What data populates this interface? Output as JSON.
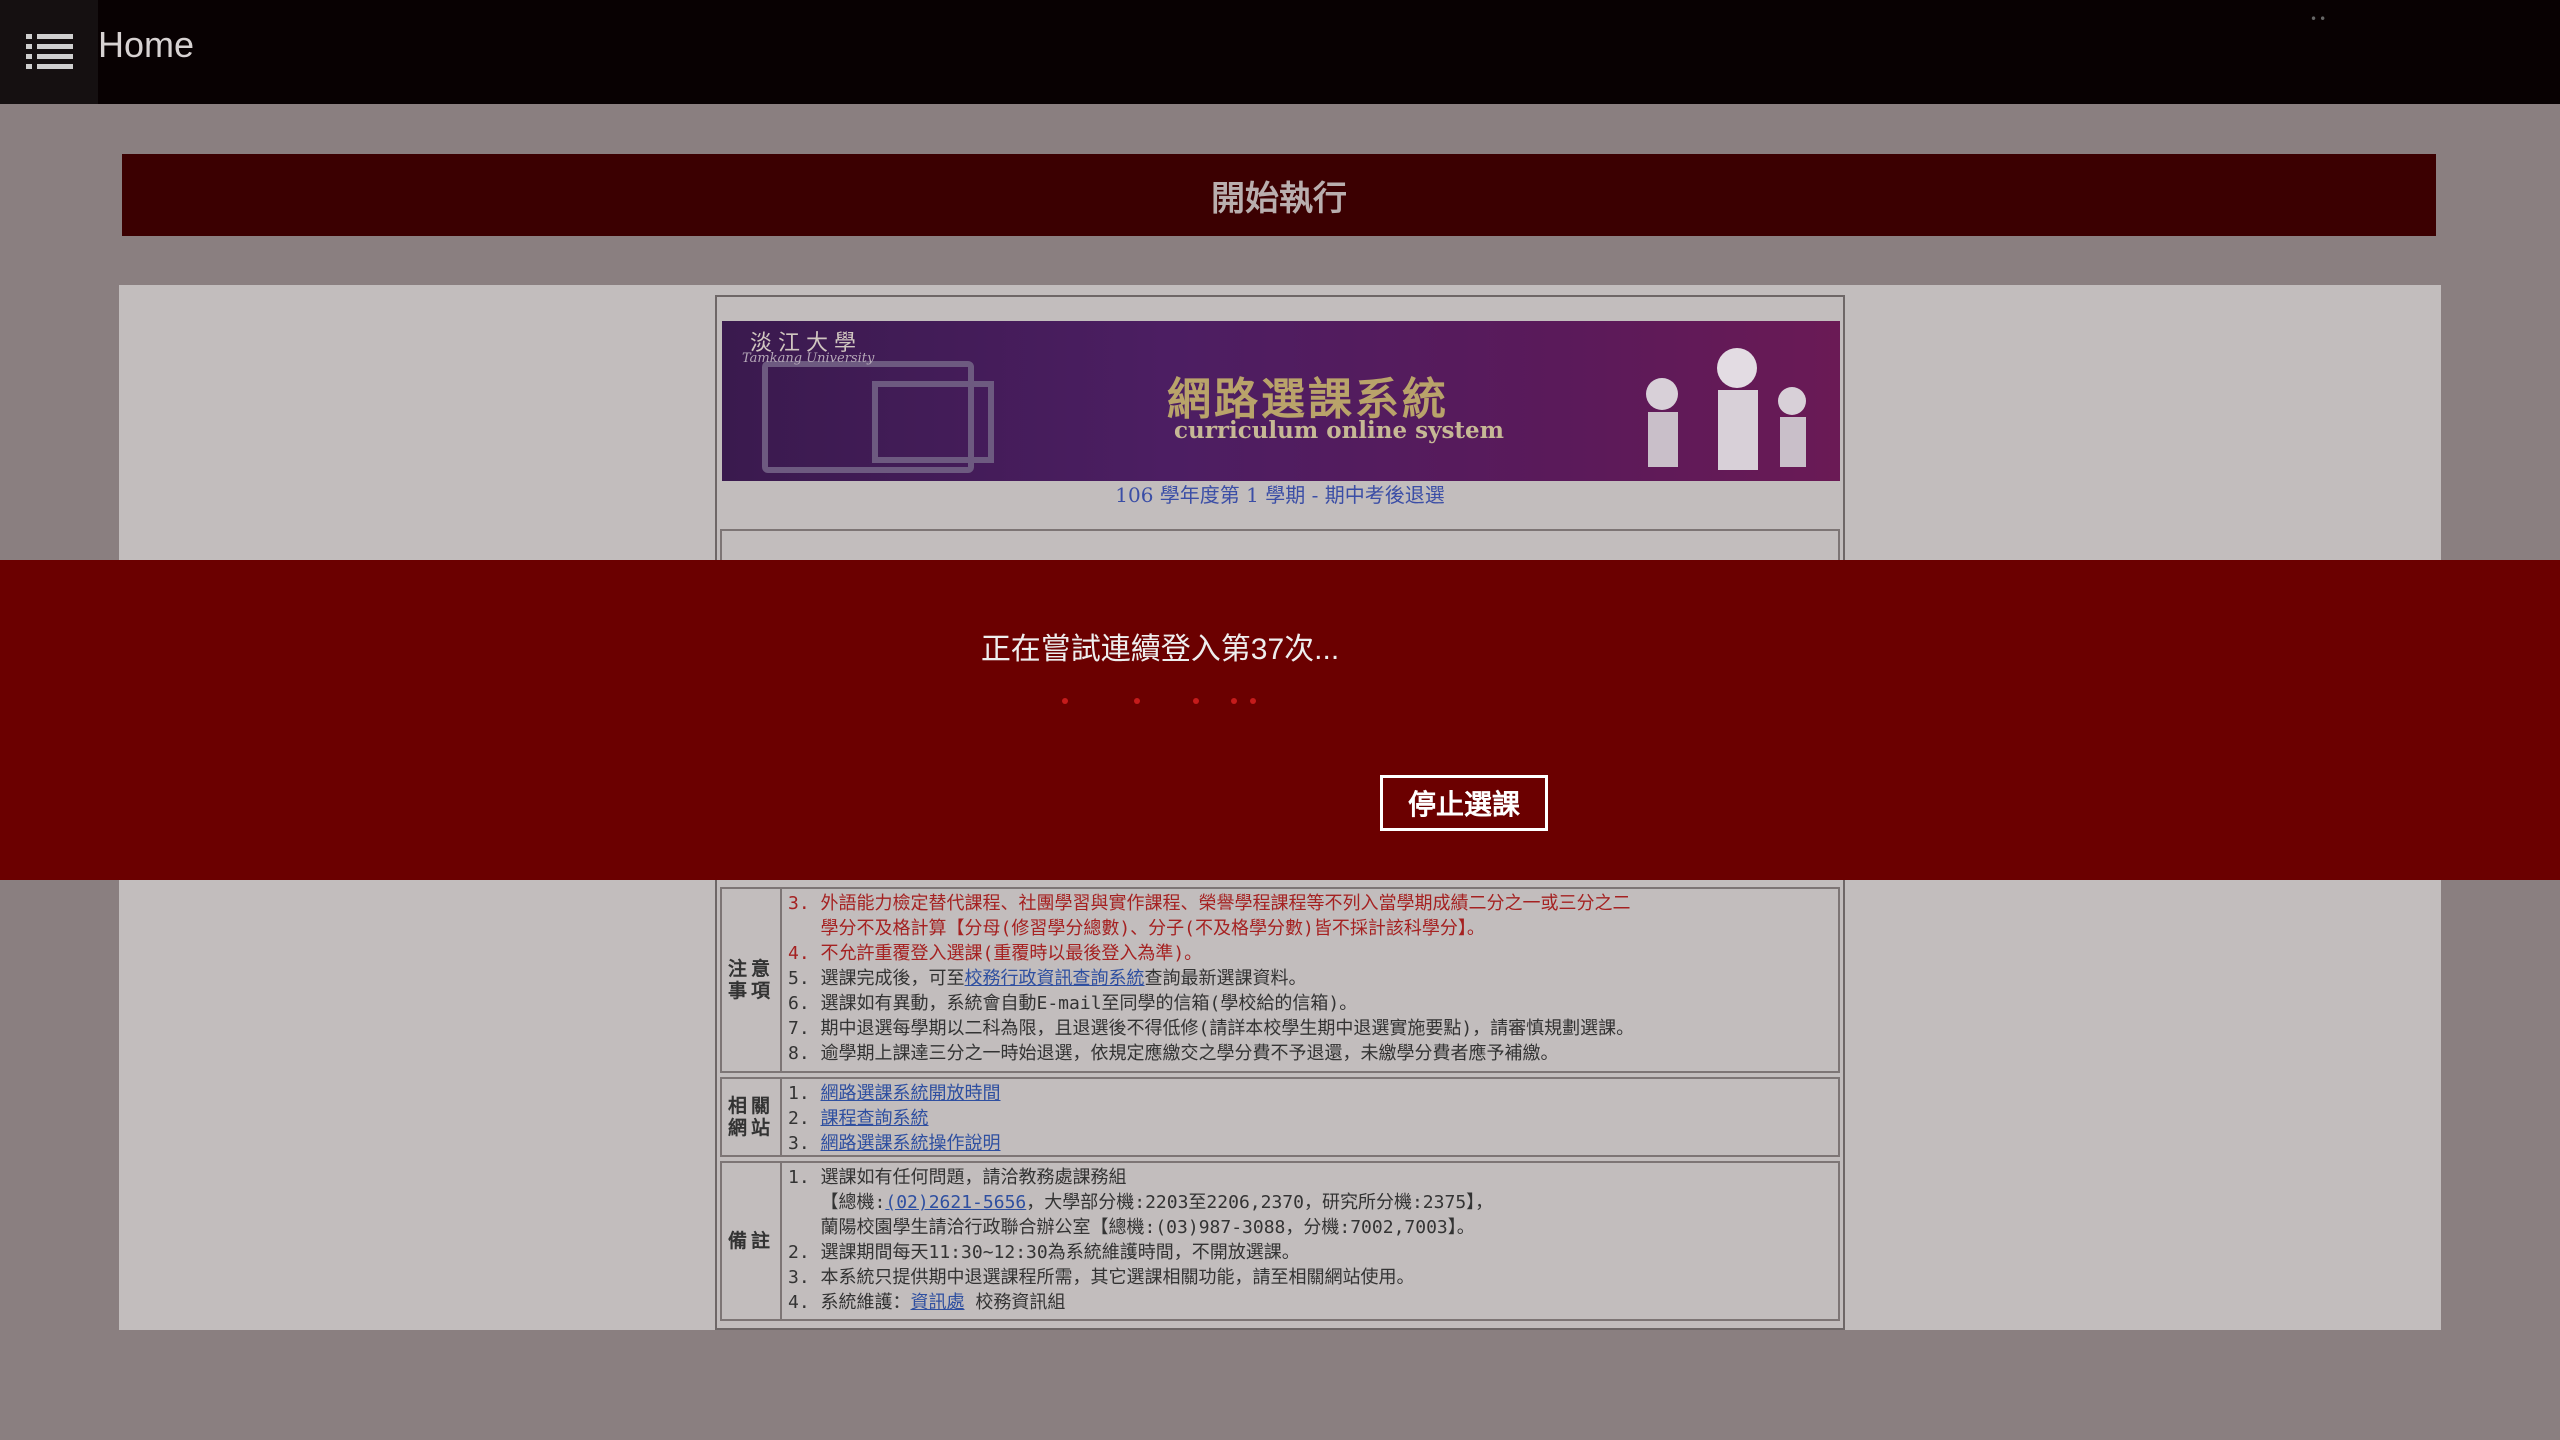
{
  "topbar": {
    "title": "Home",
    "menu_icon": "list-menu-icon",
    "dots": "••"
  },
  "run_header": {
    "label": "開始執行"
  },
  "banner": {
    "university_zh": "淡江大學",
    "university_en": "Tamkang University",
    "system_title": "網路選課系統",
    "system_subtitle": "curriculum online system",
    "term": "106 學年度第 1 學期 - 期中考後退選"
  },
  "notes": {
    "label": "注意事項",
    "item3_line1": "3. 外語能力檢定替代課程、社團學習與實作課程、榮譽學程課程等不列入當學期成績二分之一或三分之二",
    "item3_line2": "   學分不及格計算【分母(修習學分總數)、分子(不及格學分數)皆不採計該科學分】。",
    "item4": "4. 不允許重覆登入選課(重覆時以最後登入為準)。",
    "item5_pre": "5. 選課完成後，可至",
    "item5_link": "校務行政資訊查詢系統",
    "item5_post": "查詢最新選課資料。",
    "item6": "6. 選課如有異動，系統會自動E-mail至同學的信箱(學校給的信箱)。",
    "item7": "7. 期中退選每學期以二科為限，且退選後不得低修(請詳本校學生期中退選實施要點)，請審慎規劃選課。",
    "item8": "8. 逾學期上課達三分之一時始退選，依規定應繳交之學分費不予退還，未繳學分費者應予補繳。"
  },
  "links": {
    "label": "相關網站",
    "items": [
      "網路選課系統開放時間",
      "課程查詢系統",
      "網路選課系統操作說明"
    ]
  },
  "remarks": {
    "label": "備註",
    "line1": "1. 選課如有任何問題，請洽教務處課務組",
    "line2_pre": "   【總機:",
    "line2_link": "(02)2621-5656",
    "line2_post": "，大學部分機:2203至2206,2370，研究所分機:2375】，",
    "line3": "   蘭陽校園學生請洽行政聯合辦公室【總機:(03)987-3088，分機:7002,7003】。",
    "line4": "2. 選課期間每天11:30~12:30為系統維護時間，不開放選課。",
    "line5": "3. 本系統只提供期中退選課程所需，其它選課相關功能，請至相關網站使用。",
    "line6_pre": "4. 系統維護：",
    "line6_link": "資訊處",
    "line6_post": " 校務資訊組"
  },
  "overlay": {
    "message": "正在嘗試連續登入第37次...",
    "stop_label": "停止選課",
    "dot_color": "#c51b1b"
  }
}
